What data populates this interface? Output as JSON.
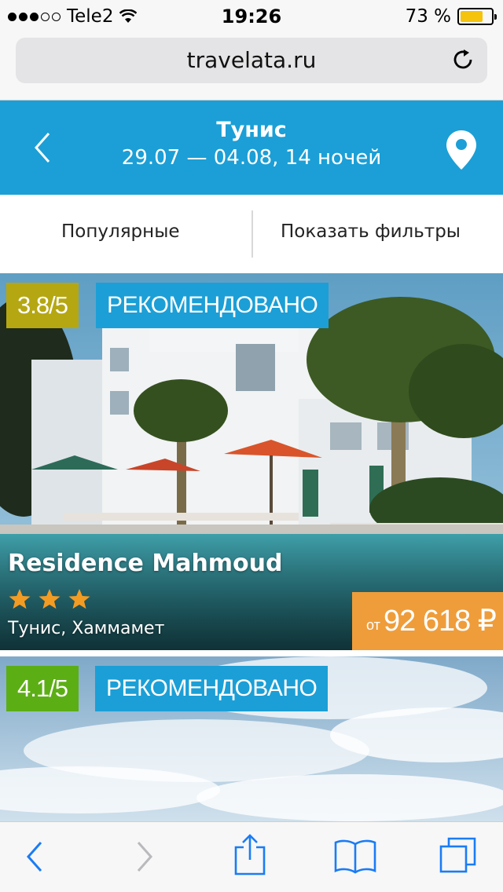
{
  "status": {
    "carrier": "Tele2",
    "time": "19:26",
    "battery_text": "73 %",
    "signal_dots": 5,
    "signal_filled": 3
  },
  "browser": {
    "url": "travelata.ru"
  },
  "header": {
    "title": "Тунис",
    "subtitle": "29.07 — 04.08, 14 ночей"
  },
  "filters": {
    "popular_label": "Популярные",
    "show_filters_label": "Показать фильтры"
  },
  "hotels": [
    {
      "rating": "3.8/5",
      "badge": "РЕКОМЕНДОВАНО",
      "name": "Residence Mahmoud",
      "stars": 3,
      "location": "Тунис, Хаммамет",
      "price_prefix": "от",
      "price": "92 618 ₽"
    },
    {
      "rating": "4.1/5",
      "badge": "РЕКОМЕНДОВАНО"
    }
  ],
  "colors": {
    "brand_blue": "#1b9fd6",
    "rating_olive": "#b5a712",
    "rating_green": "#5cae15",
    "price_orange": "#ef9d3a",
    "star_orange": "#f39c24",
    "ios_blue": "#1a7cf5"
  },
  "icons": {
    "back": "chevron-left-icon",
    "location": "map-pin-icon",
    "reload": "reload-icon",
    "toolbar": [
      "back-icon",
      "forward-icon",
      "share-icon",
      "bookmarks-icon",
      "tabs-icon"
    ]
  }
}
